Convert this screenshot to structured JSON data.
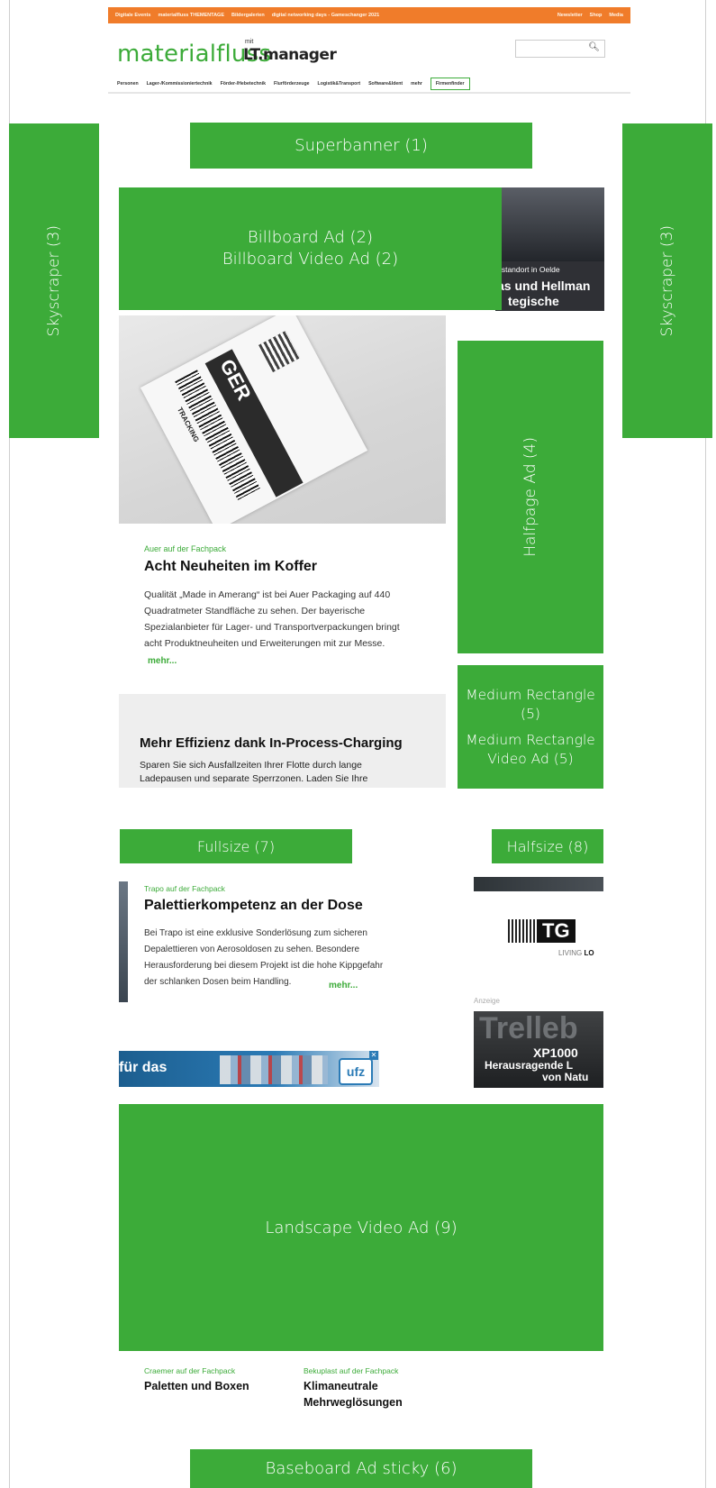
{
  "topbar": {
    "items": [
      "Digitale Events",
      "materialfluss THEMENTAGE",
      "Bildergalerien",
      "digital networking days - Gameschanger 2021",
      "Newsletter",
      "Shop",
      "Media"
    ]
  },
  "header": {
    "logo_main": "materialfluss",
    "logo_mit": "mit",
    "logo_sub": "LT.manager",
    "search_icon": "search-icon"
  },
  "nav": {
    "items": [
      "Personen",
      "Lager-/Kommissioniertechnik",
      "Förder-/Hebetechnik",
      "Flurförderzeuge",
      "Logistik&Transport",
      "Software&Ident",
      "mehr"
    ],
    "firmenfinder": "Firmenfinder"
  },
  "ads": {
    "superbanner": "Superbanner (1)",
    "billboard": "Billboard Ad (2)",
    "billboard_video": "Billboard Video Ad (2)",
    "skyscraper": "Skyscraper (3)",
    "halfpage": "Halfpage Ad (4)",
    "medium_rectangle": "Medium Rectangle (5)",
    "medium_rectangle_video": "Medium Rectangle Video Ad (5)",
    "fullsize": "Fullsize (7)",
    "halfsize": "Halfsize (8)",
    "landscape_video": "Landscape Video Ad (9)",
    "baseboard": "Baseboard Ad sticky (6)"
  },
  "teaser_photo": {
    "caption_small": "rstandort in Oelde",
    "caption_line1": "as und Hellman",
    "caption_line2": "tegische"
  },
  "label_image": {
    "big_text": "GER",
    "tracking": "TRACKING"
  },
  "article1": {
    "kicker": "Auer auf der Fachpack",
    "headline": "Acht Neuheiten im Koffer",
    "body_lines": [
      "Qualität „Made in Amerang“ ist bei Auer Packaging auf 440",
      "Quadratmeter Standfläche zu sehen. Der bayerische",
      "Spezialanbieter für Lager- und Transportverpackungen bringt",
      "acht Produktneuheiten und Erweiterungen mit zur Messe."
    ],
    "more": "mehr..."
  },
  "article2": {
    "headline": "Mehr Effizienz dank In-Process-Charging",
    "body_lines": [
      "Sparen Sie sich Ausfallzeiten Ihrer Flotte durch lange",
      "Ladepausen und separate Sperrzonen. Laden Sie Ihre"
    ]
  },
  "article3": {
    "kicker": "Trapo auf der Fachpack",
    "headline": "Palettierkompetenz an der Dose",
    "body_lines": [
      "Bei Trapo ist eine exklusive Sonderlösung zum sicheren",
      "Depalettieren von Aerosoldosen zu sehen. Besondere",
      "Herausforderung bei diesem Projekt ist die hohe Kippgefahr",
      "der schlanken Dosen beim Handling."
    ],
    "more": "mehr..."
  },
  "right_ads": {
    "tg_letters": "TG",
    "tg_tagline_a": "LIVING ",
    "tg_tagline_b": "LO",
    "anzeige": "Anzeige",
    "treb_title": "Trelleb",
    "treb_model": "XP1000",
    "treb_line1": "Herausragende L",
    "treb_line2": "von Natu"
  },
  "ufz_banner": {
    "text": "für das",
    "logo": "ufz",
    "close": "✕"
  },
  "bottom_teasers": [
    {
      "kicker": "Craemer auf der Fachpack",
      "headline_lines": [
        "Paletten und Boxen"
      ]
    },
    {
      "kicker": "Bekuplast auf der Fachpack",
      "headline_lines": [
        "Klimaneutrale",
        "Mehrweglösungen"
      ]
    }
  ]
}
